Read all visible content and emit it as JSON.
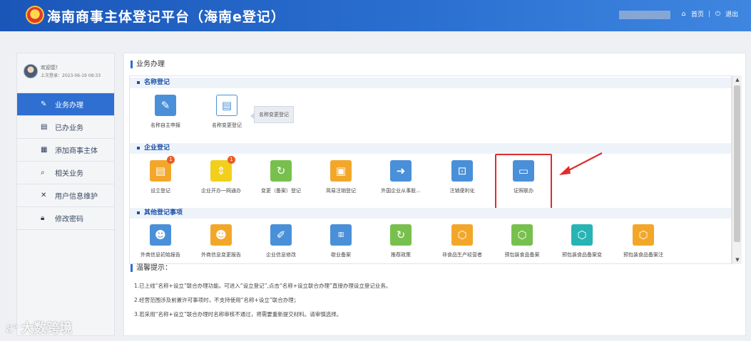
{
  "header": {
    "title": "海南商事主体登记平台（海南e登记）",
    "home_label": "首页",
    "separator": "|",
    "logout_label": "退出",
    "home_icon": "home-icon",
    "logout_icon": "power-icon"
  },
  "sidebar": {
    "welcome": "欢迎您！",
    "last_login": "上次登录：2023-06-19 08:33",
    "items": [
      {
        "label": "业务办理",
        "icon": "edit-icon",
        "active": true
      },
      {
        "label": "已办业务",
        "icon": "document-icon",
        "active": false
      },
      {
        "label": "添加商事主体",
        "icon": "building-icon",
        "active": false
      },
      {
        "label": "相关业务",
        "icon": "search-doc-icon",
        "active": false
      },
      {
        "label": "用户信息维护",
        "icon": "wrench-icon",
        "active": false
      },
      {
        "label": "修改密码",
        "icon": "lock-icon",
        "active": false
      }
    ]
  },
  "main": {
    "breadcrumb": "业务办理",
    "sections": [
      {
        "title": "名称登记",
        "tiles": [
          {
            "label": "名称自主申报",
            "icon": "edit-doc-icon",
            "color": "#4a90d9",
            "style": "solid"
          },
          {
            "label": "名称变更登记",
            "icon": "clipboard-icon",
            "color": "#4a90d9",
            "style": "outline"
          }
        ]
      },
      {
        "title": "企业登记",
        "tiles": [
          {
            "label": "设立登记",
            "icon": "clipboard-icon",
            "color": "#f3a72a",
            "badge": "1"
          },
          {
            "label": "企业开办一网通办",
            "icon": "merge-icon",
            "color": "#f2cf1d",
            "badge": "1"
          },
          {
            "label": "变更（备案）登记",
            "icon": "doc-refresh-icon",
            "color": "#78c04d"
          },
          {
            "label": "简易注销登记",
            "icon": "chart-doc-icon",
            "color": "#f3a72a"
          },
          {
            "label": "外国企业从事股...",
            "icon": "export-icon",
            "color": "#4a90d9"
          },
          {
            "label": "注销便利化",
            "icon": "scan-icon",
            "color": "#4a90d9"
          },
          {
            "label": "证照联办",
            "icon": "card-icon",
            "color": "#4a90d9"
          }
        ]
      },
      {
        "title": "其他登记事项",
        "tiles": [
          {
            "label": "外商信息初始报告",
            "icon": "person-icon",
            "color": "#4a90d9"
          },
          {
            "label": "外商信息变更报告",
            "icon": "person-icon",
            "color": "#f3a72a"
          },
          {
            "label": "企业信息修改",
            "icon": "user-edit-icon",
            "color": "#4a90d9"
          },
          {
            "label": "歇业备案",
            "icon": "rest-icon",
            "color": "#4a90d9"
          },
          {
            "label": "推荐政策",
            "icon": "doc-refresh-icon",
            "color": "#78c04d"
          },
          {
            "label": "非食品生产经营者",
            "icon": "box-icon",
            "color": "#f3a72a"
          },
          {
            "label": "预包装食品备案",
            "icon": "box-icon",
            "color": "#78c04d"
          },
          {
            "label": "预包装食品备案变",
            "icon": "box-icon",
            "color": "#28b4b4"
          },
          {
            "label": "预包装食品备案注",
            "icon": "box-icon",
            "color": "#f3a72a"
          }
        ]
      }
    ],
    "tooltip": "名称变更登记",
    "scroll_up": "▲",
    "scroll_down": "▼"
  },
  "tips": {
    "title": "温馨提示：",
    "items": [
      "1.已上线“名称+设立”联合办理功能。可进入“设立登记”,点击“名称+设立联合办理”直接办理设立登记业务。",
      "2.经营范围涉及前置许可事项时，不支持使用“名称+设立”联合办理；",
      "3.若采用“名称+设立”联合办理时名称审核不通过，将需要重新提交材料。请审慎选择。"
    ]
  },
  "watermark": {
    "text": "大数跨境"
  },
  "colors": {
    "header": "#2a6fd0",
    "active_menu": "#2f6fd2",
    "highlight": "#e02c2c"
  }
}
